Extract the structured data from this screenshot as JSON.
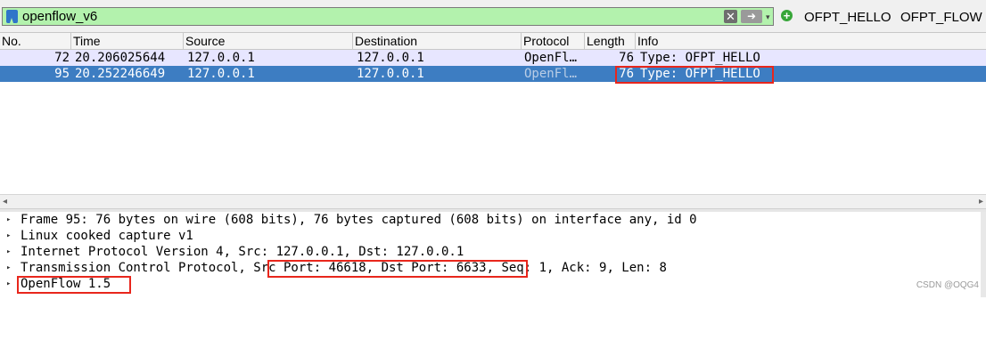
{
  "filter": {
    "value": "openflow_v6",
    "clear_icon": "✕",
    "apply_icon": "➜",
    "dropdown_icon": "▾",
    "add_icon": "+",
    "quick_buttons": [
      "OFPT_HELLO",
      "OFPT_FLOW"
    ]
  },
  "packet_list": {
    "columns": [
      "No.",
      "Time",
      "Source",
      "Destination",
      "Protocol",
      "Length",
      "Info"
    ],
    "rows": [
      {
        "no": "72",
        "time": "20.206025644",
        "source": "127.0.0.1",
        "destination": "127.0.0.1",
        "protocol": "OpenFl…",
        "length": "76",
        "info": "Type: OFPT_HELLO"
      },
      {
        "no": "95",
        "time": "20.252246649",
        "source": "127.0.0.1",
        "destination": "127.0.0.1",
        "protocol": "OpenFl…",
        "length": "76",
        "info": "Type: OFPT_HELLO"
      }
    ],
    "scroll_left_icon": "◂",
    "scroll_right_icon": "▸"
  },
  "details": {
    "expand_icon": "▸",
    "rows": [
      "Frame 95: 76 bytes on wire (608 bits), 76 bytes captured (608 bits) on interface any, id 0",
      "Linux cooked capture v1",
      "Internet Protocol Version 4, Src: 127.0.0.1, Dst: 127.0.0.1",
      "Transmission Control Protocol, Src Port: 46618, Dst Port: 6633, Seq: 1, Ack: 9, Len: 8",
      "OpenFlow 1.5"
    ]
  },
  "colors": {
    "filter_valid_bg": "#b3f2ad",
    "selected_row": "#3d7dc2",
    "row_bg": "#e7e6ff",
    "highlight_box": "#e8261c"
  },
  "watermark": "CSDN @OQG4"
}
